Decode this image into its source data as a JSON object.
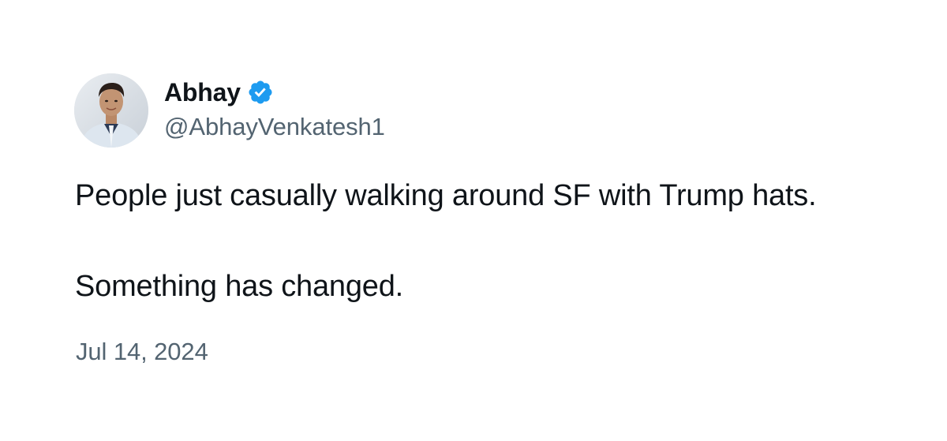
{
  "author": {
    "display_name": "Abhay",
    "handle": "@AbhayVenkatesh1",
    "verified_icon": "verified-badge-icon",
    "verified_color": "#1d9bf0",
    "avatar_icon": "profile-photo"
  },
  "tweet": {
    "lines": [
      "People just casually walking around SF with Trump hats.",
      "Something has changed."
    ],
    "date": "Jul 14, 2024"
  },
  "colors": {
    "text_primary": "#0f1419",
    "text_secondary": "#536471",
    "background": "#ffffff"
  }
}
